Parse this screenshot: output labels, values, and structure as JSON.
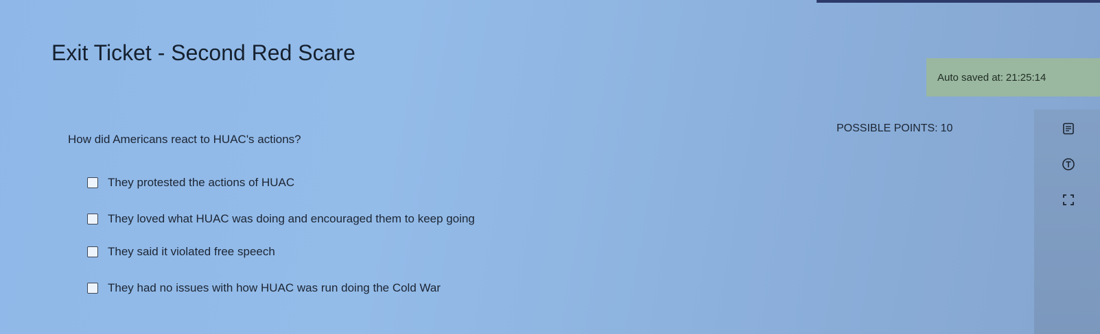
{
  "assignment": {
    "title": "Exit Ticket - Second Red Scare",
    "autosave_label": "Auto saved at:",
    "autosave_time": "21:25:14",
    "points_label": "POSSIBLE POINTS:",
    "points_value": "10"
  },
  "question": {
    "prompt": "How did Americans react to HUAC's actions?",
    "options": [
      {
        "label": "They protested the actions of HUAC",
        "checked": false
      },
      {
        "label": "They loved what HUAC was doing and encouraged them to keep going",
        "checked": false
      },
      {
        "label": "They said it violated free speech",
        "checked": false
      },
      {
        "label": "They had no issues with how HUAC was run doing the Cold War",
        "checked": false
      }
    ]
  },
  "tools": [
    {
      "icon": "notepad-icon"
    },
    {
      "icon": "text-to-speech-icon"
    },
    {
      "icon": "fullscreen-icon"
    }
  ],
  "colors": {
    "background": "#8fb8e8",
    "autosave_bg": "#9ab79f",
    "tool_panel_bg": "#829fc5"
  }
}
